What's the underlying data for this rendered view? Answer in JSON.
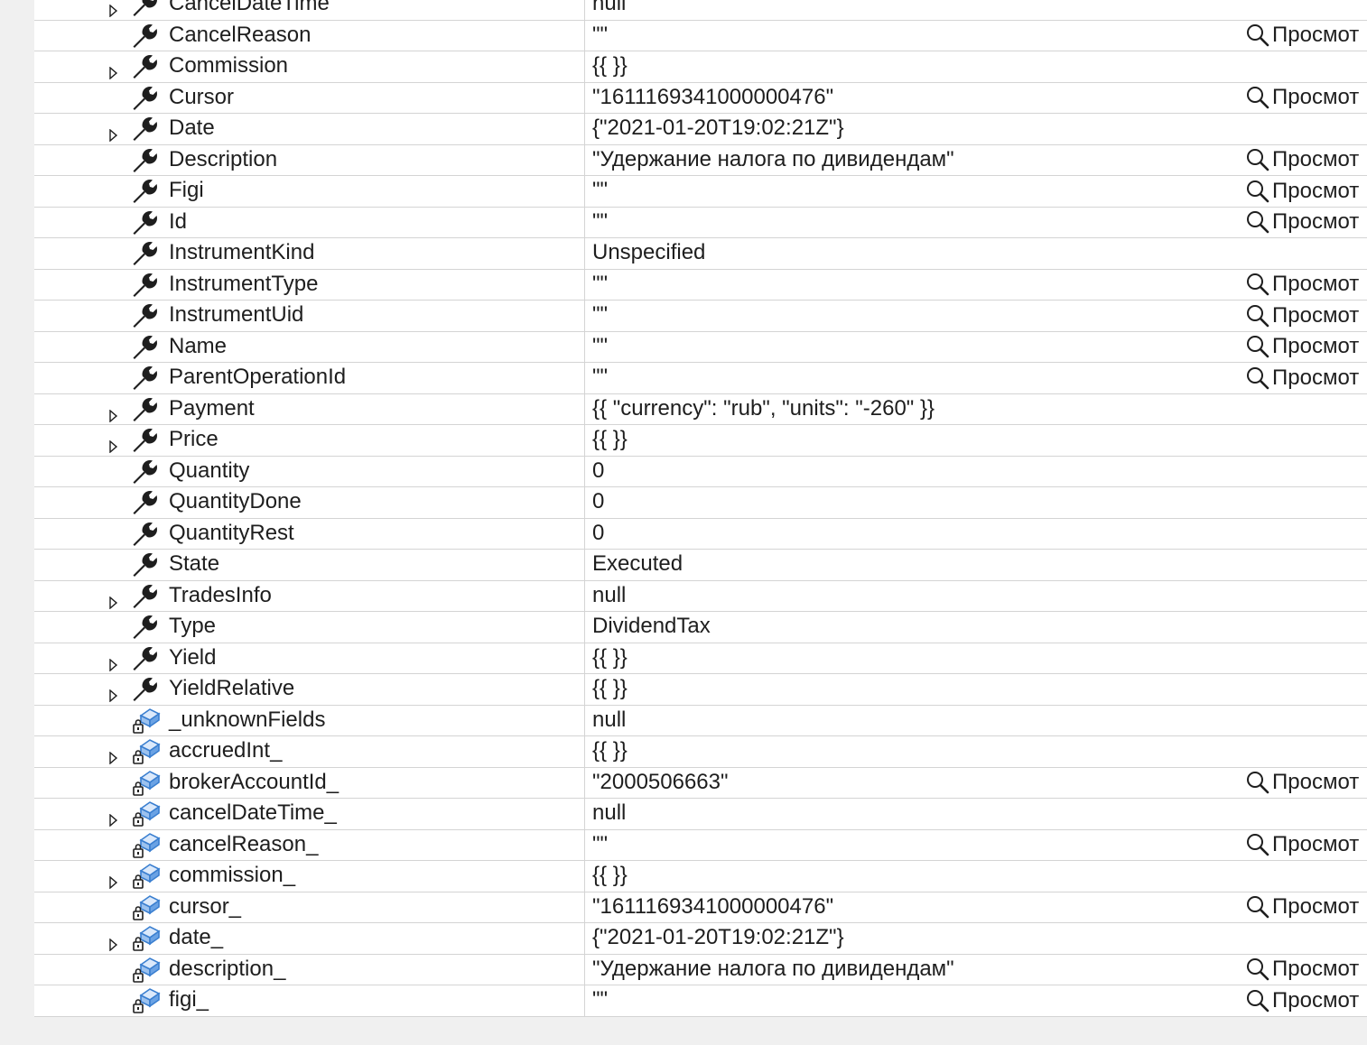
{
  "watch": {
    "view_label": "Просмот",
    "rows": [
      {
        "name": "CancelDateTime",
        "value": "null",
        "kind": "property",
        "expandable": true,
        "viewer": false
      },
      {
        "name": "CancelReason",
        "value": "\"\"",
        "kind": "property",
        "expandable": false,
        "viewer": true
      },
      {
        "name": "Commission",
        "value": "{{ }}",
        "kind": "property",
        "expandable": true,
        "viewer": false
      },
      {
        "name": "Cursor",
        "value": "\"1611169341000000476\"",
        "kind": "property",
        "expandable": false,
        "viewer": true
      },
      {
        "name": "Date",
        "value": "{\"2021-01-20T19:02:21Z\"}",
        "kind": "property",
        "expandable": true,
        "viewer": false
      },
      {
        "name": "Description",
        "value": "\"Удержание налога по дивидендам\"",
        "kind": "property",
        "expandable": false,
        "viewer": true
      },
      {
        "name": "Figi",
        "value": "\"\"",
        "kind": "property",
        "expandable": false,
        "viewer": true
      },
      {
        "name": "Id",
        "value": "\"\"",
        "kind": "property",
        "expandable": false,
        "viewer": true
      },
      {
        "name": "InstrumentKind",
        "value": "Unspecified",
        "kind": "property",
        "expandable": false,
        "viewer": false
      },
      {
        "name": "InstrumentType",
        "value": "\"\"",
        "kind": "property",
        "expandable": false,
        "viewer": true
      },
      {
        "name": "InstrumentUid",
        "value": "\"\"",
        "kind": "property",
        "expandable": false,
        "viewer": true
      },
      {
        "name": "Name",
        "value": "\"\"",
        "kind": "property",
        "expandable": false,
        "viewer": true
      },
      {
        "name": "ParentOperationId",
        "value": "\"\"",
        "kind": "property",
        "expandable": false,
        "viewer": true
      },
      {
        "name": "Payment",
        "value": "{{ \"currency\": \"rub\", \"units\": \"-260\" }}",
        "kind": "property",
        "expandable": true,
        "viewer": false
      },
      {
        "name": "Price",
        "value": "{{ }}",
        "kind": "property",
        "expandable": true,
        "viewer": false
      },
      {
        "name": "Quantity",
        "value": "0",
        "kind": "property",
        "expandable": false,
        "viewer": false
      },
      {
        "name": "QuantityDone",
        "value": "0",
        "kind": "property",
        "expandable": false,
        "viewer": false
      },
      {
        "name": "QuantityRest",
        "value": "0",
        "kind": "property",
        "expandable": false,
        "viewer": false
      },
      {
        "name": "State",
        "value": "Executed",
        "kind": "property",
        "expandable": false,
        "viewer": false
      },
      {
        "name": "TradesInfo",
        "value": "null",
        "kind": "property",
        "expandable": true,
        "viewer": false
      },
      {
        "name": "Type",
        "value": "DividendTax",
        "kind": "property",
        "expandable": false,
        "viewer": false
      },
      {
        "name": "Yield",
        "value": "{{ }}",
        "kind": "property",
        "expandable": true,
        "viewer": false
      },
      {
        "name": "YieldRelative",
        "value": "{{ }}",
        "kind": "property",
        "expandable": true,
        "viewer": false
      },
      {
        "name": "_unknownFields",
        "value": "null",
        "kind": "private-field",
        "expandable": false,
        "viewer": false
      },
      {
        "name": "accruedInt_",
        "value": "{{ }}",
        "kind": "private-field",
        "expandable": true,
        "viewer": false
      },
      {
        "name": "brokerAccountId_",
        "value": "\"2000506663\"",
        "kind": "private-field",
        "expandable": false,
        "viewer": true
      },
      {
        "name": "cancelDateTime_",
        "value": "null",
        "kind": "private-field",
        "expandable": true,
        "viewer": false
      },
      {
        "name": "cancelReason_",
        "value": "\"\"",
        "kind": "private-field",
        "expandable": false,
        "viewer": true
      },
      {
        "name": "commission_",
        "value": "{{ }}",
        "kind": "private-field",
        "expandable": true,
        "viewer": false
      },
      {
        "name": "cursor_",
        "value": "\"1611169341000000476\"",
        "kind": "private-field",
        "expandable": false,
        "viewer": true
      },
      {
        "name": "date_",
        "value": "{\"2021-01-20T19:02:21Z\"}",
        "kind": "private-field",
        "expandable": true,
        "viewer": false
      },
      {
        "name": "description_",
        "value": "\"Удержание налога по дивидендам\"",
        "kind": "private-field",
        "expandable": false,
        "viewer": true
      },
      {
        "name": "figi_",
        "value": "\"\"",
        "kind": "private-field",
        "expandable": false,
        "viewer": true
      }
    ]
  },
  "colors": {
    "grid_line": "#d4d4d4",
    "field_icon_blue": "#3a7fd0",
    "text": "#1e1e1e"
  }
}
